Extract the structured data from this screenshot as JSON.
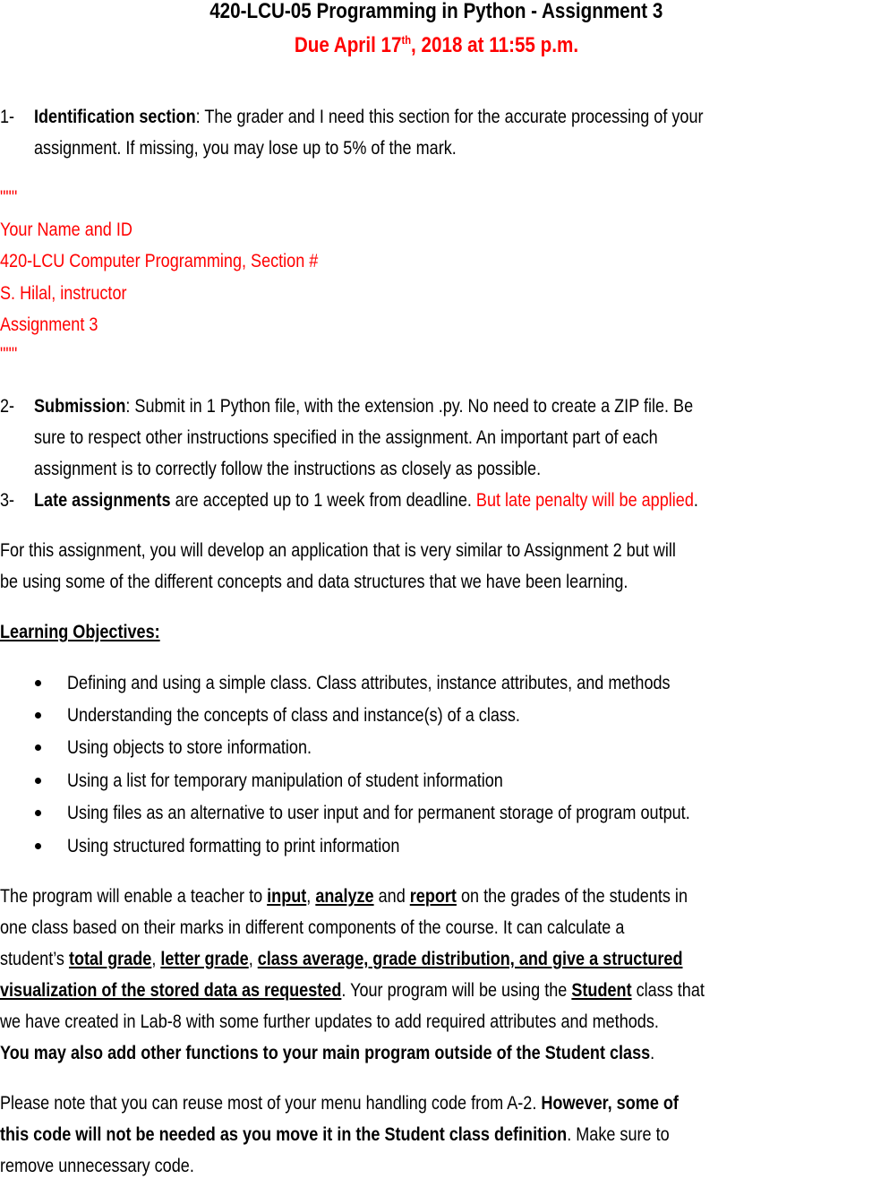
{
  "header": {
    "title": "420-LCU-05 Programming in Python - Assignment 3",
    "due_prefix": "Due April 17",
    "due_sup": "th",
    "due_suffix": ", 2018 at 11:55 p.m."
  },
  "items": [
    {
      "number": "1-",
      "bold": "Identification section",
      "line1": ": The grader and I need this section for the accurate processing of your",
      "line2": "assignment. If missing, you may lose up to 5% of the mark."
    },
    {
      "number": "2-",
      "bold": "Submission",
      "line1": ": Submit in 1 Python file, with the extension .py. No need to create a ZIP file. Be",
      "line2": "sure to respect other instructions specified in the assignment. An important part of each",
      "line3": "assignment is to correctly follow the instructions as closely as possible."
    },
    {
      "number": "3-",
      "bold": "Late assignments",
      "text": " are accepted up to 1 week from deadline. ",
      "red": "But late penalty will be applied",
      "end": "."
    }
  ],
  "id_block": [
    "\"\"\"",
    "Your Name and ID",
    "420-LCU Computer Programming, Section #",
    "S. Hilal, instructor",
    "Assignment 3",
    "\"\"\""
  ],
  "intro": [
    "For this assignment, you will develop an application that is very similar to Assignment 2 but will",
    "be using some of the different concepts and data structures that we have been learning."
  ],
  "objectives": {
    "heading": "Learning Objectives:",
    "bullets": [
      "Defining and using a simple class. Class  attributes, instance attributes, and methods",
      "Understanding the concepts of class and instance(s) of a class.",
      "Using objects to store information.",
      "Using a list for temporary manipulation of student information",
      "Using files as an alternative to user input and for permanent storage of program output.",
      "Using structured formatting to print information"
    ]
  },
  "program": {
    "l1a": "The program will enable a teacher to ",
    "input": "input",
    "comma1": ", ",
    "analyze": "analyze",
    "and1": " and ",
    "report": "report",
    "l1b": " on the grades of the students in",
    "l2": "one class based on their marks in different components of the course. It can calculate a",
    "l3a": "student’s ",
    "total": "total grade",
    "comma2": ", ",
    "letter": "letter grade",
    "comma3": ", ",
    "l3u": "class average, grade distribution, and give a structured",
    "l4u": "visualization of the stored data as requested",
    "l4a": ". Your program will be using the ",
    "student": "Student",
    "l4b": " class that",
    "l5": "we have created in Lab-8 with some further updates to add required attributes and methods.",
    "l6b": "You may also add other functions to your main program outside of the Student class",
    "l6end": "."
  },
  "note": {
    "l1a": "Please note that you can reuse most of your menu handling code from A-2. ",
    "l1b": "However, some of",
    "l2b": "this code will not be needed as you move it in the Student class definition",
    "l2a": ". Make sure to",
    "l3": "remove unnecessary code."
  }
}
